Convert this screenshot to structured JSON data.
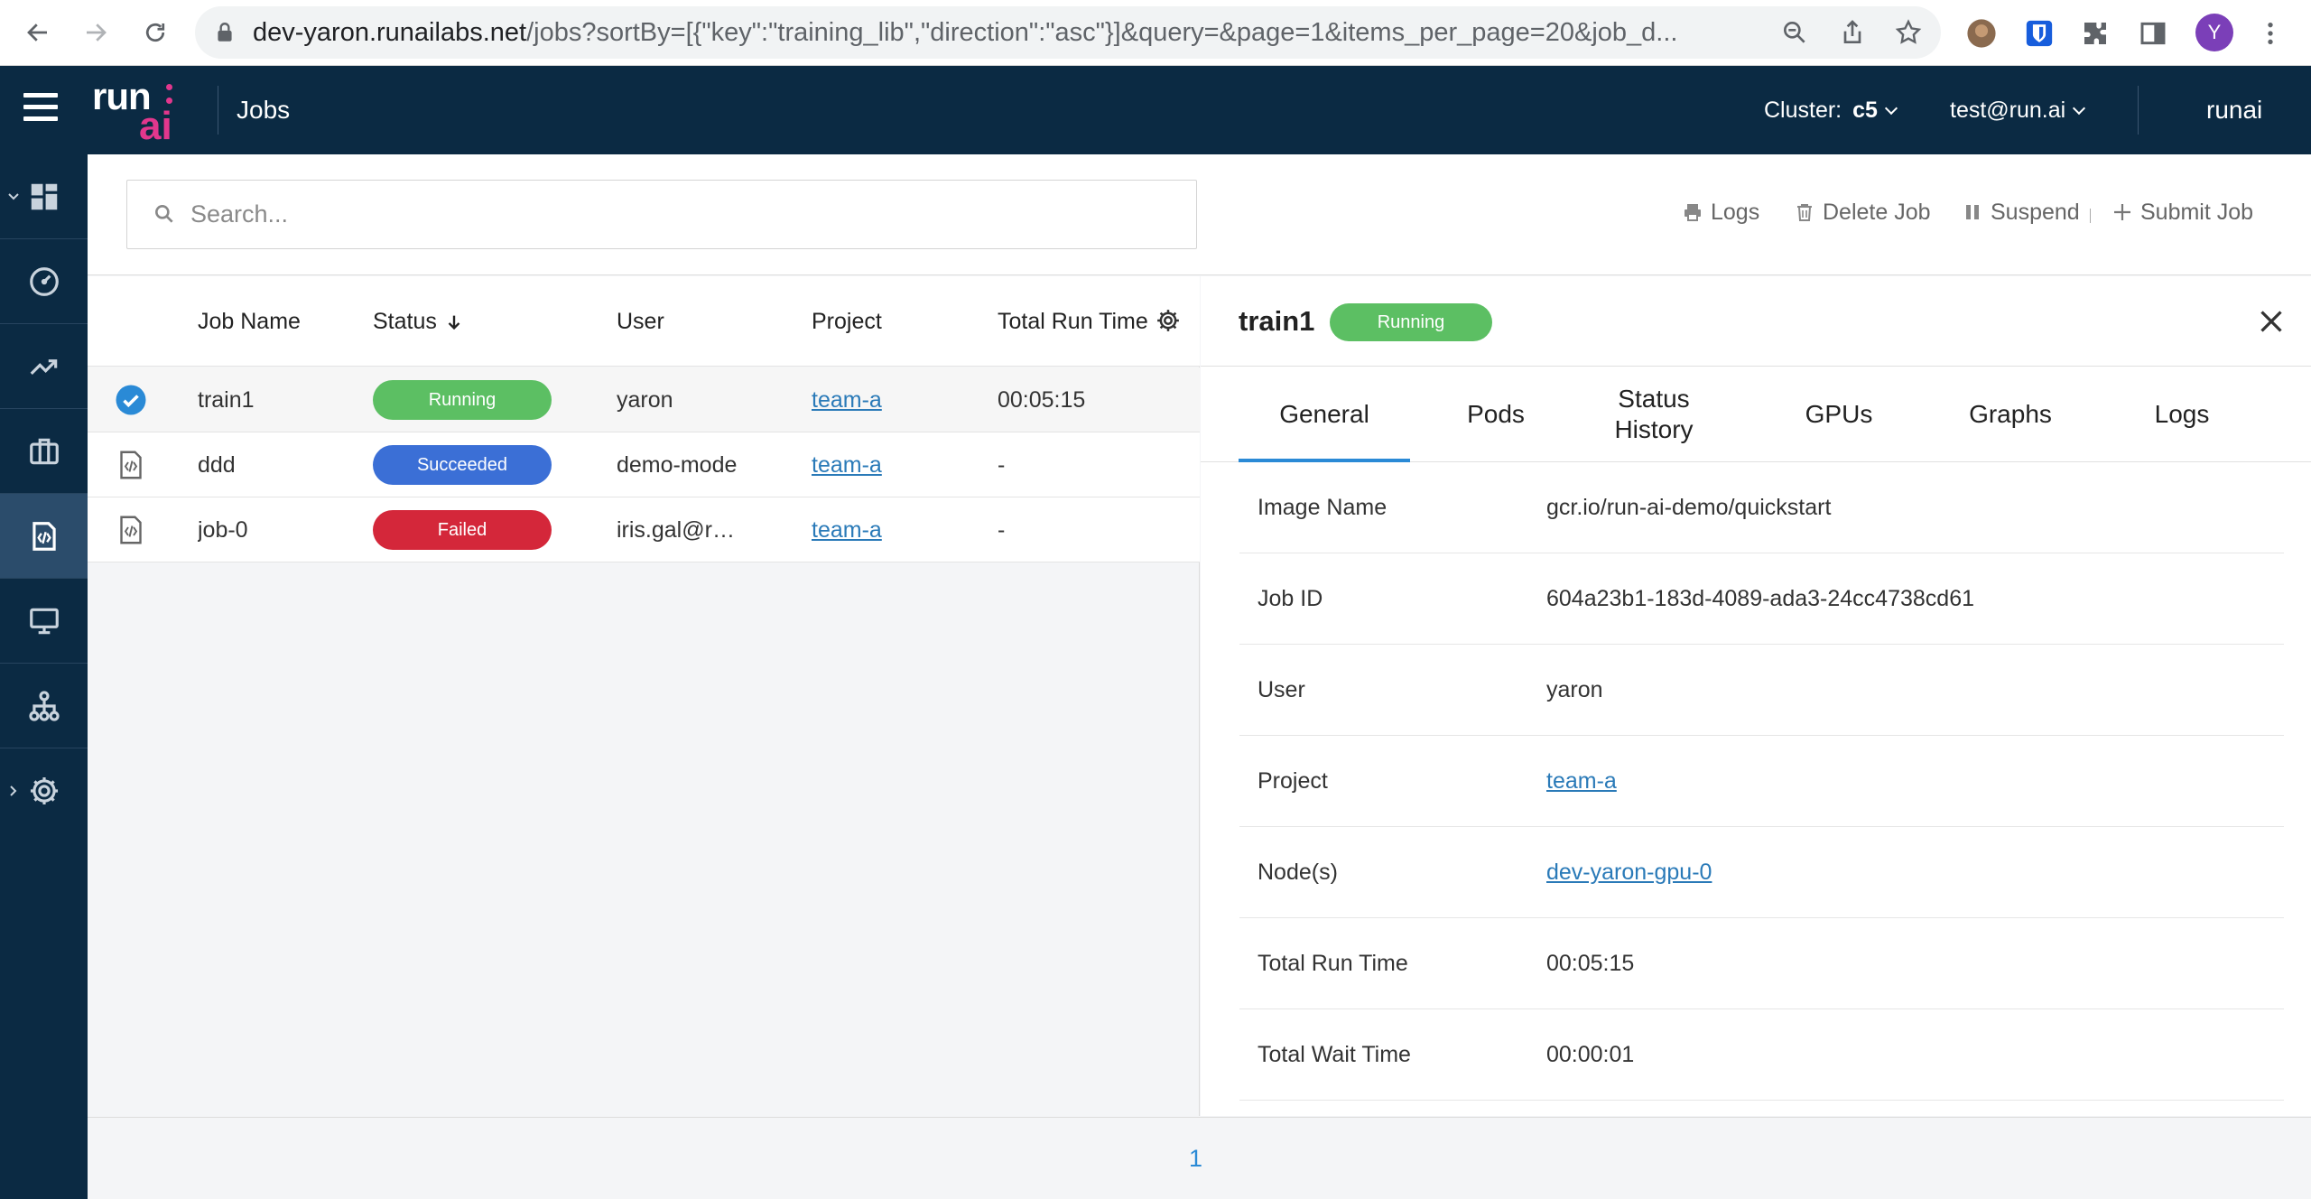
{
  "browser": {
    "url_host": "dev-yaron.runailabs.net",
    "url_rest": "/jobs?sortBy=[{\"key\":\"training_lib\",\"direction\":\"asc\"}]&query=&page=1&items_per_page=20&job_d...",
    "profile_initial": "Y",
    "icons": [
      "back-arrow-icon",
      "forward-arrow-icon",
      "reload-icon",
      "lock-icon",
      "zoom-icon",
      "share-icon",
      "star-icon",
      "extension-avatar-icon",
      "bitwarden-icon",
      "puzzle-icon",
      "sidepanel-icon",
      "kebab-menu-icon"
    ]
  },
  "header": {
    "title": "Jobs",
    "logo_run": "run",
    "logo_ai": "ai",
    "cluster_label": "Cluster:",
    "cluster_value": "c5",
    "user": "test@run.ai",
    "tenant": "runai"
  },
  "sidebar": {
    "items": [
      {
        "icon": "dashboard-icon",
        "active": false,
        "expandable": true
      },
      {
        "icon": "speedometer-icon",
        "active": false
      },
      {
        "icon": "trend-chart-icon",
        "active": false
      },
      {
        "icon": "briefcase-icon",
        "active": false
      },
      {
        "icon": "job-file-icon",
        "active": true
      },
      {
        "icon": "monitor-icon",
        "active": false
      },
      {
        "icon": "hierarchy-icon",
        "active": false
      },
      {
        "icon": "settings-icon",
        "active": false,
        "expandable": true
      }
    ]
  },
  "toolbar": {
    "search_placeholder": "Search...",
    "logs": "Logs",
    "delete_job": "Delete Job",
    "suspend": "Suspend",
    "submit_job": "Submit Job"
  },
  "table": {
    "columns": [
      "Job Name",
      "Status",
      "User",
      "Project",
      "Total Run Time"
    ],
    "rows": [
      {
        "name": "train1",
        "status": "Running",
        "user": "yaron",
        "project": "team-a",
        "run_time": "00:05:15",
        "selected": true
      },
      {
        "name": "ddd",
        "status": "Succeeded",
        "user": "demo-mode",
        "project": "team-a",
        "run_time": "-",
        "selected": false
      },
      {
        "name": "job-0",
        "status": "Failed",
        "user": "iris.gal@ru...",
        "project": "team-a",
        "run_time": "-",
        "selected": false
      }
    ]
  },
  "status_colors": {
    "Running": "#5cbf63",
    "Succeeded": "#3b6fd6",
    "Failed": "#d4273a"
  },
  "detail": {
    "title": "train1",
    "status": "Running",
    "tabs": [
      "General",
      "Pods",
      "Status History",
      "GPUs",
      "Graphs",
      "Logs"
    ],
    "active_tab": "General",
    "fields": [
      {
        "label": "Image Name",
        "value": "gcr.io/run-ai-demo/quickstart",
        "link": false
      },
      {
        "label": "Job ID",
        "value": "604a23b1-183d-4089-ada3-24cc4738cd61",
        "link": false
      },
      {
        "label": "User",
        "value": "yaron",
        "link": false
      },
      {
        "label": "Project",
        "value": "team-a",
        "link": true
      },
      {
        "label": "Node(s)",
        "value": "dev-yaron-gpu-0",
        "link": true
      },
      {
        "label": "Total Run Time",
        "value": "00:05:15",
        "link": false
      },
      {
        "label": "Total Wait Time",
        "value": "00:00:01",
        "link": false
      }
    ]
  },
  "pagination": {
    "current_page": "1"
  }
}
